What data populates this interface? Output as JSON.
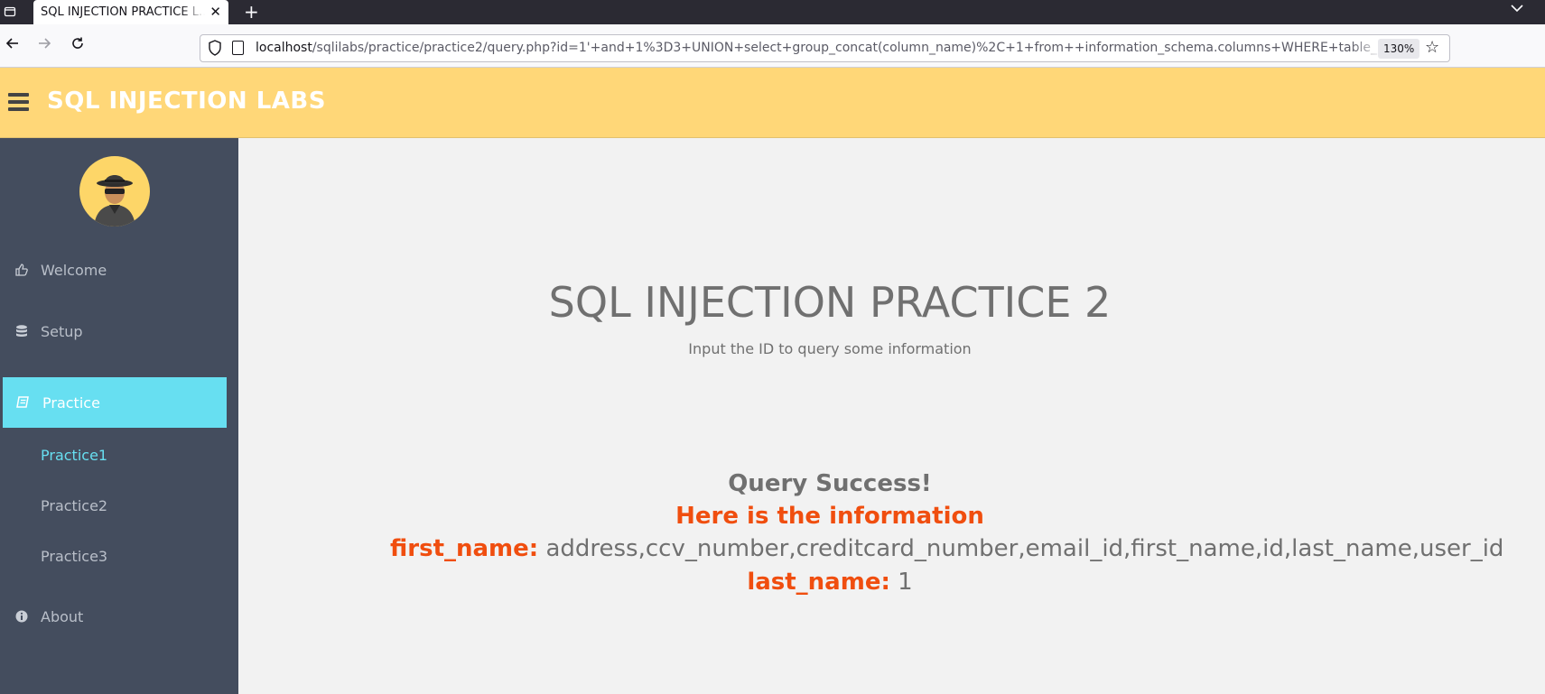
{
  "browser": {
    "tab_title": "SQL INJECTION PRACTICE L…",
    "url_host": "localhost",
    "url_path": "/sqlilabs/practice/practice2/query.php?id=1'+and+1%3D3+UNION+select+group_concat(column_name)%2C+1+from++information_schema.columns+WHERE+table_name",
    "zoom": "130%"
  },
  "header": {
    "brand": "SQL INJECTION LABS"
  },
  "sidebar": {
    "items": [
      {
        "label": "Welcome",
        "icon": "thumbs-up-icon"
      },
      {
        "label": "Setup",
        "icon": "database-icon"
      },
      {
        "label": "Practice",
        "icon": "book-icon"
      },
      {
        "label": "About",
        "icon": "info-icon"
      }
    ],
    "subitems": [
      {
        "label": "Practice1"
      },
      {
        "label": "Practice2"
      },
      {
        "label": "Practice3"
      }
    ]
  },
  "main": {
    "title": "SQL INJECTION PRACTICE 2",
    "subtitle": "Input the ID to query some information",
    "status": "Query Success!",
    "info_heading": "Here is the information",
    "results": [
      {
        "key": "first_name:",
        "value": "address,ccv_number,creditcard_number,email_id,first_name,id,last_name,user_id"
      },
      {
        "key": "last_name:",
        "value": "1"
      }
    ]
  },
  "colors": {
    "header_bg": "#ffd778",
    "sidebar_bg": "#444d5e",
    "active_item": "#67dff1",
    "accent_text": "#f04e0f"
  }
}
